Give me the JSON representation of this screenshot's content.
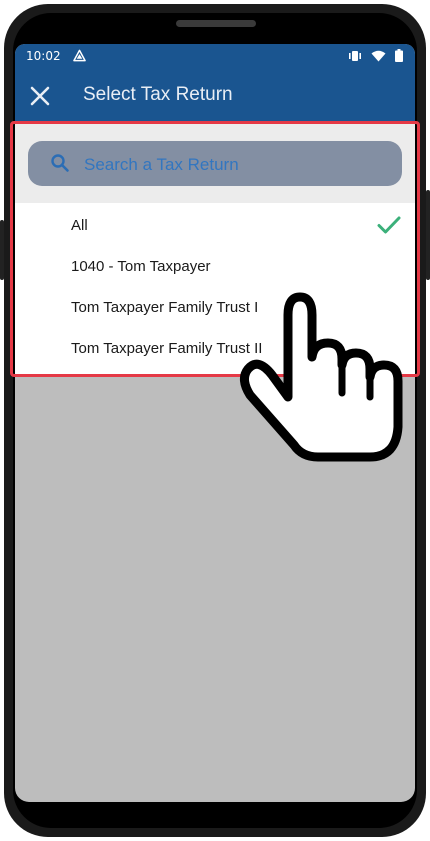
{
  "status_bar": {
    "time": "10:02",
    "icons": [
      "alert-triangle-icon",
      "vibrate-icon",
      "wifi-icon",
      "battery-icon"
    ]
  },
  "app_bar": {
    "title": "Select Tax Return",
    "close_icon": "close-icon"
  },
  "search": {
    "placeholder": "Search a Tax Return",
    "value": ""
  },
  "list": {
    "items": [
      {
        "label": "All",
        "selected": true
      },
      {
        "label": "1040 - Tom Taxpayer",
        "selected": false
      },
      {
        "label": "Tom Taxpayer Family Trust I",
        "selected": false
      },
      {
        "label": "Tom Taxpayer Family Trust II",
        "selected": false
      }
    ]
  },
  "colors": {
    "app_bar": "#1a5590",
    "search_box": "#838fa3",
    "accent_text": "#3276c0",
    "check": "#3bb07a",
    "highlight": "#e53946",
    "overlay": "#bdbdbd"
  },
  "overlay_icon": "pointing-hand-icon"
}
